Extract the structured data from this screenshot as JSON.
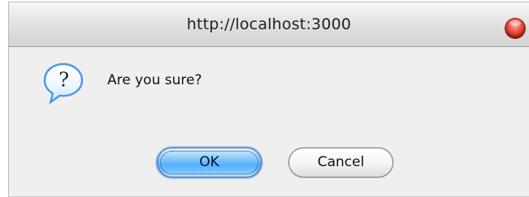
{
  "window": {
    "title": "http://localhost:3000"
  },
  "dialog": {
    "message": "Are you sure?"
  },
  "buttons": {
    "ok_label": "OK",
    "cancel_label": "Cancel"
  },
  "icons": {
    "close": "close-icon",
    "question": "question-icon"
  },
  "colors": {
    "close_button": "#d63a2b",
    "ok_button": "#5db5ff",
    "cancel_button": "#f3f3f3",
    "question_icon": "#6fb4ff"
  }
}
